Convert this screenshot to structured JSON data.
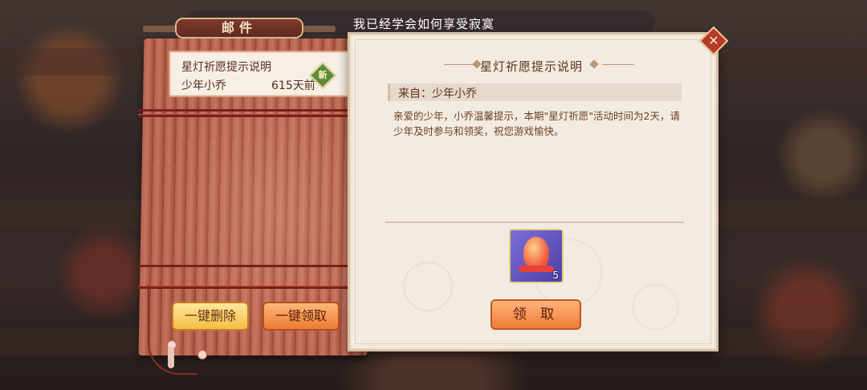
{
  "notice": {
    "text": "我已经学会如何享受寂寞"
  },
  "mailbox": {
    "title": "邮件"
  },
  "mail_list": [
    {
      "subject": "星灯祈愿提示说明",
      "sender": "少年小乔",
      "time": "615天前",
      "badge": "新"
    }
  ],
  "actions": {
    "delete_all": "一键删除",
    "claim_all": "一键领取"
  },
  "detail": {
    "title": "星灯祈愿提示说明",
    "from": "来自：少年小乔",
    "body": "亲爱的少年，小乔温馨提示，本期\"星灯祈愿\"活动时间为2天，请少年及时参与和领奖，祝您游戏愉快。",
    "reward": {
      "icon": "star-lantern-icon",
      "count": "5"
    },
    "claim_button": "领 取"
  },
  "close_icon": "close-icon",
  "colors": {
    "accent": "#ef7b38",
    "scroll": "#b4624e",
    "paper": "#f3ebe1"
  }
}
